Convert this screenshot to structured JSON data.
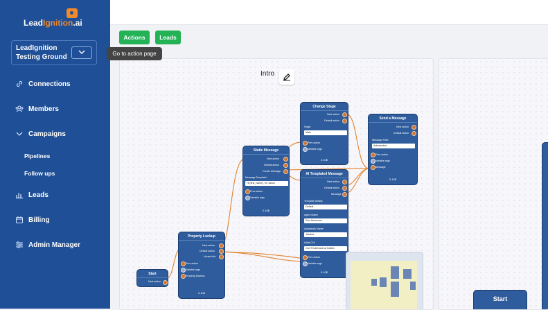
{
  "brand": {
    "logo_text_1": "Lead",
    "logo_text_2": "Ignition",
    "logo_text_3": ".ai"
  },
  "workspace": {
    "name": "LeadIgnition Testing Ground"
  },
  "sidebar": {
    "items": [
      {
        "label": "Connections",
        "icon": "link-icon"
      },
      {
        "label": "Members",
        "icon": "members-icon"
      },
      {
        "label": "Campaigns",
        "icon": "chevron-down-icon"
      },
      {
        "label": "Leads",
        "icon": "bar-chart-icon"
      },
      {
        "label": "Billing",
        "icon": "calendar-icon"
      },
      {
        "label": "Admin Manager",
        "icon": "sliders-icon"
      }
    ],
    "sub_items": [
      {
        "label": "Pipelines"
      },
      {
        "label": "Follow ups"
      }
    ]
  },
  "tabs": {
    "actions": "Actions",
    "leads": "Leads"
  },
  "tooltip": "Go to action page",
  "canvas": {
    "title": "Intro"
  },
  "nodes": {
    "start": {
      "title": "Start",
      "rows": [
        "Next action"
      ]
    },
    "property_lookup": {
      "title": "Property Lookup",
      "outputs": [
        "Next action",
        "Default action",
        "House Info"
      ],
      "inputs": [
        "Prev action",
        "Variable args",
        "Property Address"
      ],
      "cost": "0.10$"
    },
    "static_message": {
      "title": "Static Message",
      "outputs": [
        "Next action",
        "Default action",
        "Create Message"
      ],
      "field_label": "Message Template*",
      "field_value": "Hi {first_name}, I'm Jason",
      "inputs": [
        "Prev action",
        "Variable args"
      ],
      "cost": "0.10$"
    },
    "change_stage": {
      "title": "Change Stage",
      "outputs": [
        "Next action",
        "Default action"
      ],
      "field_label": "Stage",
      "field_value": "Main",
      "inputs": [
        "Prev action",
        "Variable args"
      ],
      "cost": "0.10$"
    },
    "ai_templated": {
      "title": "AI Templated Message",
      "outputs": [
        "Next action",
        "Default action",
        "Message"
      ],
      "fields": [
        {
          "label": "Template Details",
          "value": "Default"
        },
        {
          "label": "Agent Name",
          "value": "Ron Henricson"
        },
        {
          "label": "Assistant's Name",
          "value": "Jessica"
        },
        {
          "label": "Initial CHI",
          "value": "Curt Tindermark at Caliber"
        }
      ],
      "inputs": [
        "Prev action",
        "Variable args"
      ],
      "cost": "0.10$"
    },
    "send_message": {
      "title": "Send a Message",
      "outputs": [
        "Next action",
        "Default action"
      ],
      "field_label": "Message Field",
      "field_value": "Autoseeded",
      "inputs": [
        "Prev action",
        "Variable args",
        "Message"
      ],
      "cost": "0.10$"
    }
  },
  "canvas2": {
    "start_label": "Start"
  }
}
